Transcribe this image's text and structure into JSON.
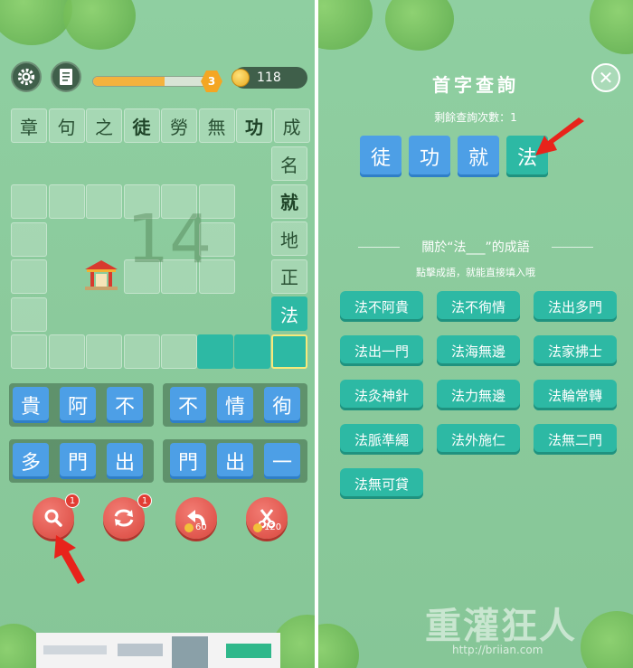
{
  "left": {
    "coins": "118",
    "level": "3",
    "progress": 0.62,
    "big_number": "14",
    "top_row": [
      "章",
      "句",
      "之",
      "徒",
      "勞",
      "無",
      "功",
      "成"
    ],
    "top_row_bold": [
      false,
      false,
      false,
      true,
      false,
      false,
      true,
      false
    ],
    "right_col": [
      "名",
      "就",
      "地",
      "正",
      "法"
    ],
    "right_col_bold": [
      false,
      true,
      false,
      false,
      false
    ],
    "options_row1_a": [
      "貴",
      "阿",
      "不"
    ],
    "options_row1_b": [
      "不",
      "情",
      "徇"
    ],
    "options_row2_a": [
      "多",
      "門",
      "出"
    ],
    "options_row2_b": [
      "門",
      "出",
      "一"
    ],
    "tools": {
      "search_badge": "1",
      "refresh_badge": "1",
      "undo_cost": "60",
      "cut_cost": "120"
    },
    "icons": [
      "gear-icon",
      "book-icon",
      "coin-icon",
      "search-icon",
      "refresh-icon",
      "undo-icon",
      "scissors-icon",
      "temple-icon"
    ]
  },
  "right": {
    "title": "首字查詢",
    "close": "✕",
    "remaining": "剩餘查詢次數：1",
    "query_chars": [
      "徒",
      "功",
      "就",
      "法"
    ],
    "selected_index": 3,
    "section_title": "關於“法___”的成語",
    "hint": "點擊成語，就能直接填入哦",
    "idioms": [
      "法不阿貴",
      "法不徇情",
      "法出多門",
      "法出一門",
      "法海無邊",
      "法家拂士",
      "法灸神針",
      "法力無邊",
      "法輪常轉",
      "法脈準繩",
      "法外施仁",
      "法無二門",
      "法無可貸"
    ]
  },
  "watermark": {
    "text": "重灌狂人",
    "url": "http://briian.com"
  },
  "colors": {
    "accent_teal": "#2db9a4",
    "option_blue": "#4d9fe6",
    "tool_red": "#d9473e",
    "arrow_red": "#e8231b"
  }
}
